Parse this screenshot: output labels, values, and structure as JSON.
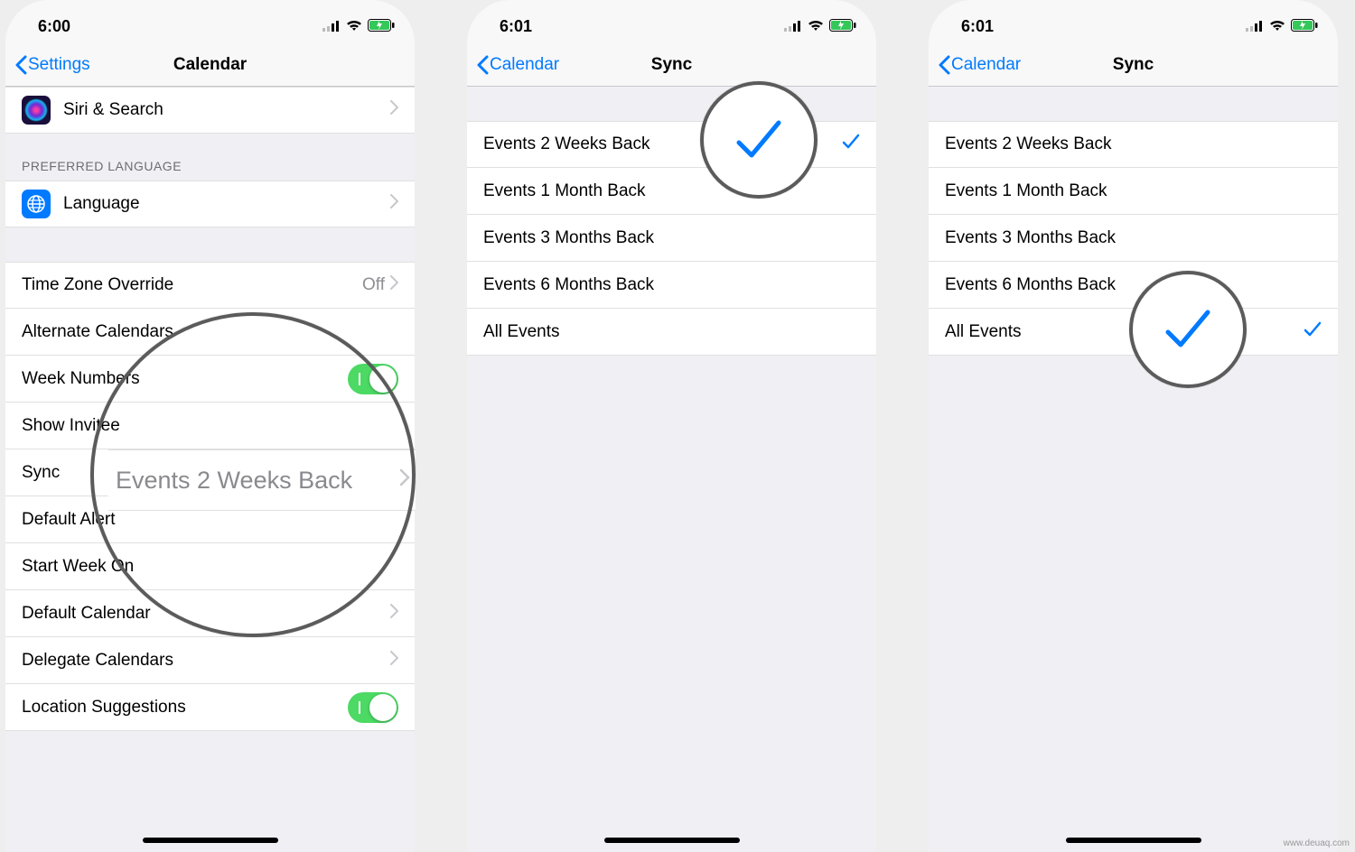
{
  "screen1": {
    "time": "6:00",
    "back": "Settings",
    "title": "Calendar",
    "siri_row": "Siri & Search",
    "pref_lang_header": "PREFERRED LANGUAGE",
    "language_row": "Language",
    "rows": {
      "tz_override": {
        "label": "Time Zone Override",
        "value": "Off"
      },
      "alt_cal": "Alternate Calendars",
      "week_numbers": "Week Numbers",
      "show_invitee": "Show Invitee",
      "sync": {
        "label": "Sync",
        "value": "Events 2 Weeks Back"
      },
      "default_alert": "Default Alert",
      "start_week": "Start Week On",
      "default_calendar": "Default Calendar",
      "delegate": "Delegate Calendars",
      "location_sugg": "Location Suggestions"
    },
    "magnify_text": "Events 2 Weeks Back"
  },
  "screen2": {
    "time": "6:01",
    "back": "Calendar",
    "title": "Sync",
    "options": [
      "Events 2 Weeks Back",
      "Events 1 Month Back",
      "Events 3 Months Back",
      "Events 6 Months Back",
      "All Events"
    ],
    "selected_index": 0
  },
  "screen3": {
    "time": "6:01",
    "back": "Calendar",
    "title": "Sync",
    "options": [
      "Events 2 Weeks Back",
      "Events 1 Month Back",
      "Events 3 Months Back",
      "Events 6 Months Back",
      "All Events"
    ],
    "selected_index": 4
  },
  "watermark": "www.deuaq.com"
}
